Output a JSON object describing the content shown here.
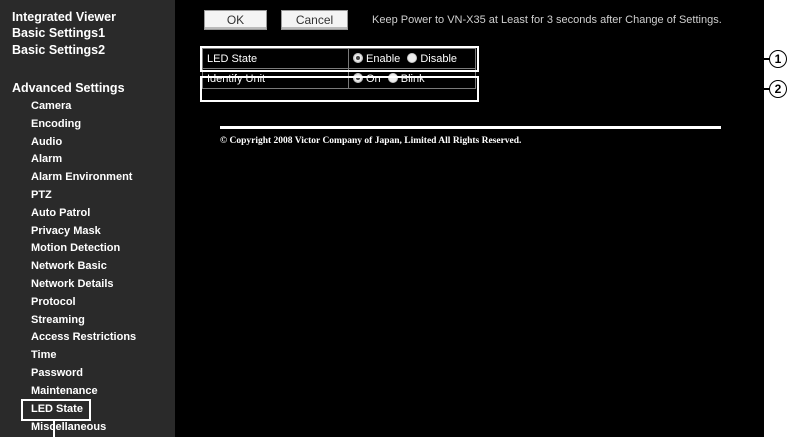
{
  "sidebar": {
    "integrated_viewer": "Integrated Viewer",
    "basic_settings1": "Basic Settings1",
    "basic_settings2": "Basic Settings2",
    "advanced_settings": "Advanced Settings",
    "items": [
      "Camera",
      "Encoding",
      "Audio",
      "Alarm",
      "Alarm Environment",
      "PTZ",
      "Auto Patrol",
      "Privacy Mask",
      "Motion Detection",
      "Network Basic",
      "Network Details",
      "Protocol",
      "Streaming",
      "Access Restrictions",
      "Time",
      "Password",
      "Maintenance",
      "LED State",
      "Miscellaneous"
    ]
  },
  "toolbar": {
    "ok_label": "OK",
    "cancel_label": "Cancel",
    "notice": "Keep Power to VN-X35 at Least for 3 seconds after Change of Settings."
  },
  "settings": {
    "led_state": {
      "label": "LED State",
      "options": [
        "Enable",
        "Disable"
      ],
      "selected": "Enable"
    },
    "identify_unit": {
      "label": "Identify Unit",
      "options": [
        "On",
        "Blink"
      ],
      "selected": "On"
    }
  },
  "footer": {
    "copyright": "© Copyright 2008 Victor Company of Japan, Limited All Rights Reserved."
  },
  "callouts": [
    "1",
    "2"
  ],
  "colors": {
    "sidebar_bg": "#2a2a2a",
    "content_bg": "#000000",
    "text": "#ffffff"
  }
}
